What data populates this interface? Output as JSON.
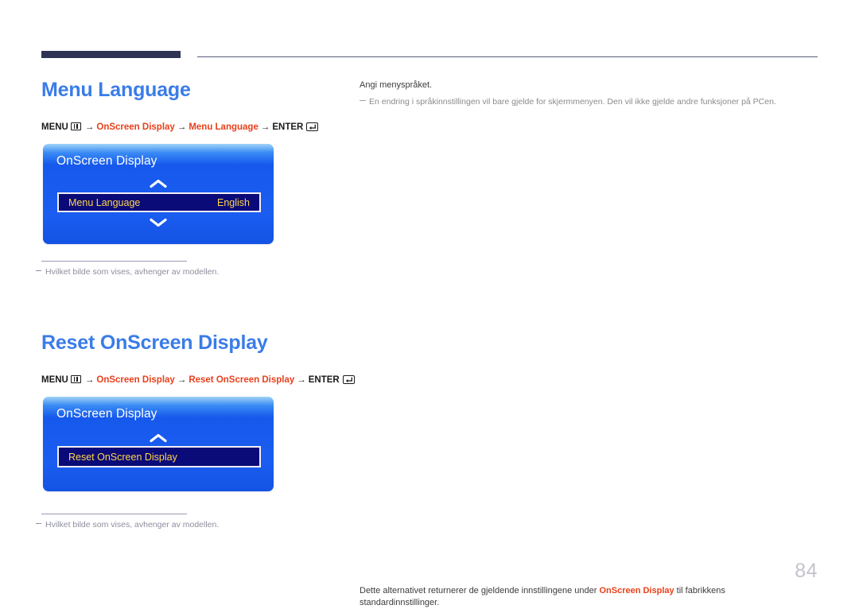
{
  "page": {
    "number": "84",
    "divider_thick_color": "#2e3255",
    "divider_thin_color": "#5a5f7d",
    "heading_color": "#3a7ce8",
    "accent_red": "#e8401c"
  },
  "sections": [
    {
      "heading": "Menu Language",
      "breadcrumb": {
        "menu_label": "MENU",
        "menu_icon": "menu-grid-icon",
        "arrow": "→",
        "path": [
          "OnScreen Display",
          "Menu Language"
        ],
        "enter_label": "ENTER",
        "enter_icon": "enter-return-icon"
      },
      "osd": {
        "title": "OnScreen Display",
        "chevron_up_icon": "chevron-up-icon",
        "chevron_down_icon": "chevron-down-icon",
        "has_chevron_down": true,
        "row": {
          "label": "Menu Language",
          "value": "English"
        },
        "bg_color": "#1a5df0",
        "row_bg_color": "#0a0a78",
        "row_text_color": "#ffd64a"
      },
      "footnote": "Hvilket bilde som vises, avhenger av modellen.",
      "description": {
        "main": "Angi menyspråket.",
        "sub": "En endring i språkinnstillingen vil bare gjelde for skjermmenyen. Den vil ikke gjelde andre funksjoner på PCen."
      }
    },
    {
      "heading": "Reset OnScreen Display",
      "breadcrumb": {
        "menu_label": "MENU",
        "menu_icon": "menu-grid-icon",
        "arrow": "→",
        "path": [
          "OnScreen Display",
          "Reset OnScreen Display"
        ],
        "enter_label": "ENTER",
        "enter_icon": "enter-return-icon"
      },
      "osd": {
        "title": "OnScreen Display",
        "chevron_up_icon": "chevron-up-icon",
        "chevron_down_icon": "chevron-down-icon",
        "has_chevron_down": false,
        "row": {
          "label": "Reset OnScreen Display",
          "value": ""
        },
        "bg_color": "#1a5df0",
        "row_bg_color": "#0a0a78",
        "row_text_color": "#ffd64a"
      },
      "footnote": "Hvilket bilde som vises, avhenger av modellen.",
      "description": {
        "main_before": "Dette alternativet returnerer de gjeldende innstillingene under ",
        "main_highlight": "OnScreen Display",
        "main_after": " til fabrikkens standardinnstillinger.",
        "sub": ""
      }
    }
  ]
}
